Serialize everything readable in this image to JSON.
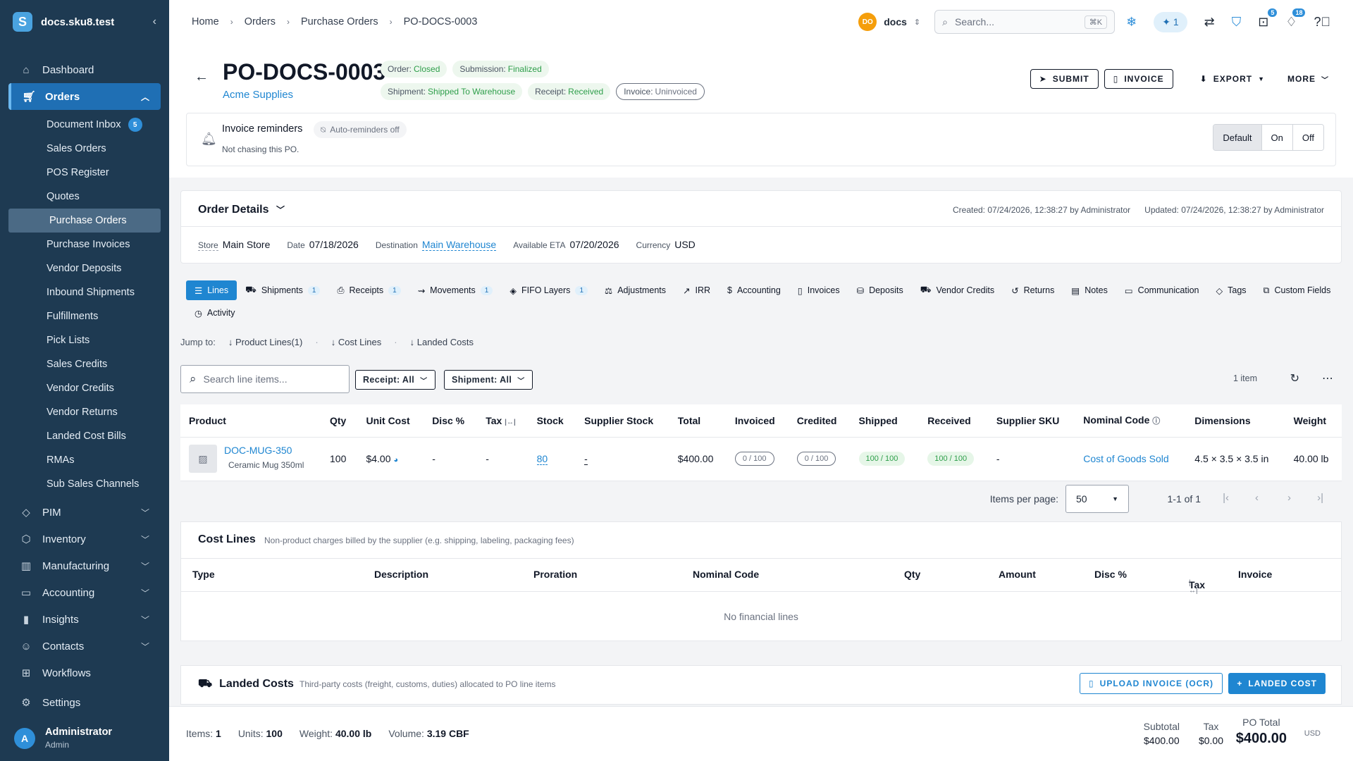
{
  "sidebar": {
    "site": "docs.sku8.test",
    "dashboard": "Dashboard",
    "orders": "Orders",
    "subitems": [
      "Document Inbox",
      "Sales Orders",
      "POS Register",
      "Quotes",
      "Purchase Orders",
      "Purchase Invoices",
      "Vendor Deposits",
      "Inbound Shipments",
      "Fulfillments",
      "Pick Lists",
      "Sales Credits",
      "Vendor Credits",
      "Vendor Returns",
      "Landed Cost Bills",
      "RMAs",
      "Sub Sales Channels"
    ],
    "inbox_badge": "5",
    "groups": [
      "PIM",
      "Inventory",
      "Manufacturing",
      "Accounting",
      "Insights",
      "Contacts"
    ],
    "workflows": "Workflows",
    "settings": "Settings",
    "user_initial": "A",
    "user_name": "Administrator",
    "user_role": "Admin"
  },
  "topbar": {
    "breadcrumb": [
      "Home",
      "Orders",
      "Purchase Orders",
      "PO-DOCS-0003"
    ],
    "store_initials": "DO",
    "store_name": "docs",
    "search_placeholder": "Search...",
    "search_shortcut": "⌘K",
    "ai_count": "1",
    "gift_badge": "5",
    "notif_badge": "18"
  },
  "header": {
    "po_number": "PO-DOCS-0003",
    "vendor": "Acme Supplies",
    "chips": [
      {
        "label": "Order:",
        "value": "Closed"
      },
      {
        "label": "Submission:",
        "value": "Finalized"
      },
      {
        "label": "Shipment:",
        "value": "Shipped To Warehouse"
      },
      {
        "label": "Receipt:",
        "value": "Received"
      },
      {
        "label": "Invoice:",
        "value": "Uninvoiced"
      }
    ],
    "submit": "SUBMIT",
    "invoice": "INVOICE",
    "export": "EXPORT",
    "more": "MORE"
  },
  "reminders": {
    "title": "Invoice reminders",
    "chip": "Auto-reminders off",
    "subtitle": "Not chasing this PO.",
    "options": [
      "Default",
      "On",
      "Off"
    ]
  },
  "order_details": {
    "title": "Order Details",
    "created": "Created: 07/24/2026, 12:38:27 by Administrator",
    "updated": "Updated: 07/24/2026, 12:38:27 by Administrator",
    "store_label": "Store",
    "store": "Main Store",
    "date_label": "Date",
    "date": "07/18/2026",
    "destination_label": "Destination",
    "destination": "Main Warehouse",
    "eta_label": "Available ETA",
    "eta": "07/20/2026",
    "currency_label": "Currency",
    "currency": "USD"
  },
  "tabs": [
    {
      "label": "Lines",
      "count": ""
    },
    {
      "label": "Shipments",
      "count": "1"
    },
    {
      "label": "Receipts",
      "count": "1"
    },
    {
      "label": "Movements",
      "count": "1"
    },
    {
      "label": "FIFO Layers",
      "count": "1"
    },
    {
      "label": "Adjustments",
      "count": ""
    },
    {
      "label": "IRR",
      "count": ""
    },
    {
      "label": "Accounting",
      "count": ""
    },
    {
      "label": "Invoices",
      "count": ""
    },
    {
      "label": "Deposits",
      "count": ""
    },
    {
      "label": "Vendor Credits",
      "count": ""
    },
    {
      "label": "Returns",
      "count": ""
    },
    {
      "label": "Notes",
      "count": ""
    },
    {
      "label": "Communication",
      "count": ""
    },
    {
      "label": "Tags",
      "count": ""
    },
    {
      "label": "Custom Fields",
      "count": ""
    },
    {
      "label": "Activity",
      "count": ""
    }
  ],
  "jump": {
    "label": "Jump to:",
    "links": [
      "Product Lines(1)",
      "Cost Lines",
      "Landed Costs"
    ]
  },
  "lines": {
    "search_placeholder": "Search line items...",
    "receipt_filter": "Receipt: All",
    "shipment_filter": "Shipment: All",
    "count": "1 item",
    "columns": [
      "Product",
      "Qty",
      "Unit Cost",
      "Disc %",
      "Tax",
      "Stock",
      "Supplier Stock",
      "Total",
      "Invoiced",
      "Credited",
      "Shipped",
      "Received",
      "Supplier SKU",
      "Nominal Code",
      "Dimensions",
      "Weight"
    ],
    "rows": [
      {
        "sku": "DOC-MUG-350",
        "name": "Ceramic Mug 350ml",
        "qty": "100",
        "unit_cost": "$4.00",
        "disc": "-",
        "tax": "-",
        "stock": "80",
        "supplier_stock": "-",
        "total": "$400.00",
        "invoiced": "0 / 100",
        "credited": "0 / 100",
        "shipped": "100 / 100",
        "received": "100 / 100",
        "supplier_sku": "-",
        "nominal_code": "Cost of Goods Sold",
        "dimensions": "4.5 × 3.5 × 3.5 in",
        "weight": "40.00 lb"
      }
    ],
    "items_per_page_label": "Items per page:",
    "items_per_page": "50",
    "range": "1-1 of 1"
  },
  "cost_lines": {
    "title": "Cost Lines",
    "subtitle": "Non-product charges billed by the supplier (e.g. shipping, labeling, packaging fees)",
    "columns": [
      "Type",
      "Description",
      "Proration",
      "Nominal Code",
      "Qty",
      "Amount",
      "Disc %",
      "Tax",
      "Invoice"
    ],
    "empty": "No financial lines"
  },
  "landed": {
    "title": "Landed Costs",
    "subtitle": "Third-party costs (freight, customs, duties) allocated to PO line items",
    "upload": "UPLOAD INVOICE (OCR)",
    "add": "LANDED COST"
  },
  "footer": {
    "items_label": "Items:",
    "items": "1",
    "units_label": "Units:",
    "units": "100",
    "weight_label": "Weight:",
    "weight": "40.00 lb",
    "volume_label": "Volume:",
    "volume": "3.19 CBF",
    "subtotal_label": "Subtotal",
    "subtotal": "$400.00",
    "tax_label": "Tax",
    "tax": "$0.00",
    "po_total_label": "PO Total",
    "po_total": "$400.00",
    "currency": "USD"
  },
  "colors": {
    "sidebar_bg": "#1e3a52",
    "accent": "#1f86d1",
    "success": "#2e9e4a"
  }
}
